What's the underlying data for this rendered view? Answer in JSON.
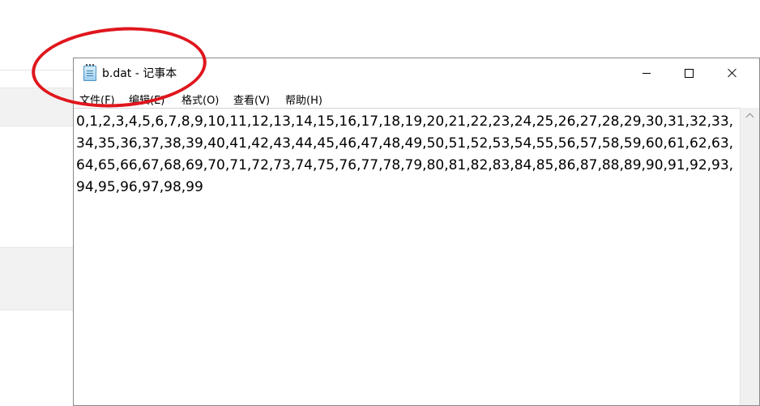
{
  "window": {
    "title": "b.dat - 记事本",
    "app_icon": "notepad-icon"
  },
  "menu": {
    "items": [
      "文件(F)",
      "编辑(E)",
      "格式(O)",
      "查看(V)",
      "帮助(H)"
    ]
  },
  "editor": {
    "content": "0,1,2,3,4,5,6,7,8,9,10,11,12,13,14,15,16,17,18,19,20,21,22,23,24,25,26,27,28,29,30,31,32,33,34,35,36,37,38,39,40,41,42,43,44,45,46,47,48,49,50,51,52,53,54,55,56,57,58,59,60,61,62,63,64,65,66,67,68,69,70,71,72,73,74,75,76,77,78,79,80,81,82,83,84,85,86,87,88,89,90,91,92,93,94,95,96,97,98,99"
  },
  "colors": {
    "annotation": "#e0161d",
    "window_border": "#8a8a8a"
  }
}
